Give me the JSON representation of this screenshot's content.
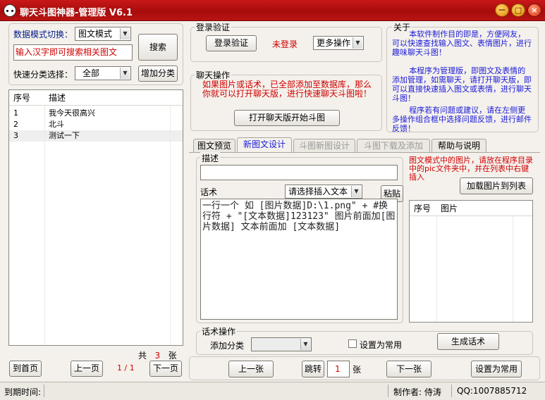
{
  "window": {
    "title": "聊天斗图神器-管理版 V6.1",
    "min": "－",
    "max": "□",
    "close": "×"
  },
  "left": {
    "mode_label": "数据模式切换：",
    "mode_value": "图文模式",
    "search_btn": "搜索",
    "search_placeholder": "输入汉字即可搜索相关图文",
    "category_label": "快速分类选择：",
    "category_value": "全部",
    "add_category_btn": "增加分类",
    "list": {
      "headers": [
        "序号",
        "描述"
      ],
      "rows": [
        {
          "no": "1",
          "desc": "我今天很高兴"
        },
        {
          "no": "2",
          "desc": "北斗"
        },
        {
          "no": "3",
          "desc": "测试一下"
        }
      ]
    },
    "total_prefix": "共",
    "total_count": "3",
    "total_suffix": "张",
    "first_page": "到首页",
    "prev_page": "上一页",
    "page_info": "1 / 1",
    "next_page": "下一页"
  },
  "login": {
    "title": "登录验证",
    "verify_btn": "登录验证",
    "status": "未登录",
    "more_ops": "更多操作"
  },
  "chat": {
    "title": "聊天操作",
    "hint": "如果图片或话术，已全部添加至数据库，那么你就可以打开聊天版，进行快速聊天斗图啦！",
    "open_btn": "打开聊天版开始斗图"
  },
  "about": {
    "title": "关于",
    "p1": "本软件制作目的即是，方便网友，可以快速查找输入图文、表情图片，进行趣味聊天斗图！",
    "p2": "本程序为管理版，即图文及表情的添加管理，如需聊天，请打开聊天版，即可以直接快速插入图文或表情，进行聊天斗图！",
    "p3": "程序若有问题或建议，请在左侧更多操作组合框中选择问题反馈，进行邮件反馈！"
  },
  "tabs": [
    "图文预览",
    "新图文设计",
    "斗图新图设计",
    "斗图下载及添加",
    "帮助与说明"
  ],
  "design": {
    "desc_label": "描述",
    "speech_label": "话术",
    "insert_select": "请选择插入文本",
    "paste_btn": "粘贴",
    "speech_text": "一行一个 如 [图片数据]D:\\1.png\" + #换行符 + \"[文本数据]123123\" 图片前面加[图片数据] 文本前面加 [文本数据]",
    "pic_note": "图文模式中的图片，请放在程序目录中的pic文件夹中，并在列表中右键插入",
    "load_pics_btn": "加载图片到列表",
    "pic_list_headers": [
      "序号",
      "图片"
    ],
    "ops_title": "话术操作",
    "add_cat_label": "添加分类",
    "add_cat_value": "",
    "set_common_chk": "设置为常用",
    "gen_btn": "生成话术"
  },
  "nav": {
    "prev": "上一张",
    "jump": "跳转",
    "page": "1",
    "unit": "张",
    "next": "下一张",
    "set_common": "设置为常用"
  },
  "status": {
    "expire": "到期时间:",
    "author": "制作者: 侍涛",
    "qq": "QQ:1007885712"
  }
}
